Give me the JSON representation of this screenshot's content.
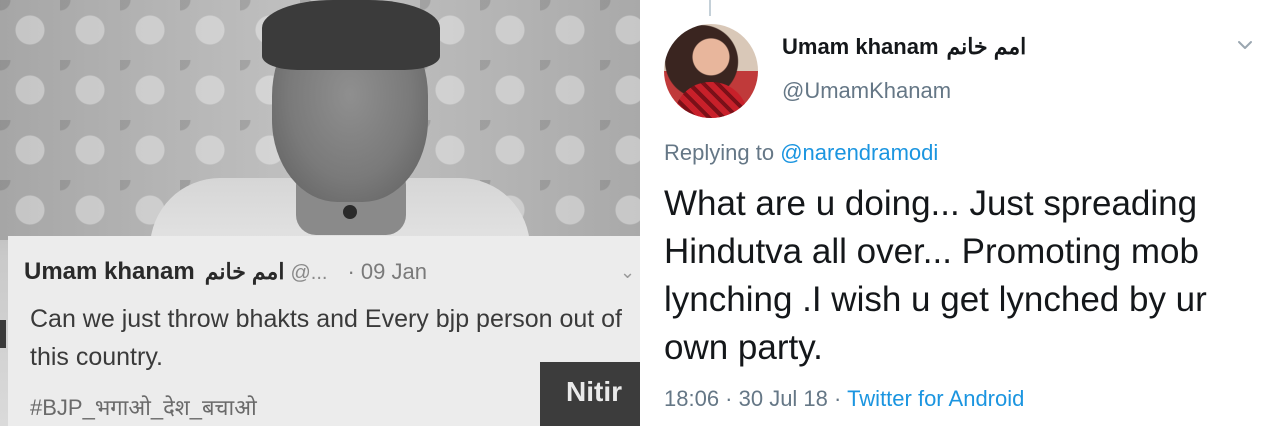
{
  "left_clipping": {
    "tweet": {
      "name": "Umam khanam",
      "urdu_name": "امم خانم",
      "handle": "@...",
      "date": "· 09 Jan",
      "body": "Can we just throw bhakts and Every bjp person out of this country.",
      "hashtag": "#BJP_भगाओ_देश_बचाओ"
    },
    "overlay_label": "Nitir"
  },
  "right_tweet": {
    "display_name": "Umam khanam",
    "urdu_name": "امم خانم",
    "handle": "@UmamKhanam",
    "replying_prefix": "Replying to",
    "replying_to": "@narendramodi",
    "text": "What are u doing... Just spreading Hindutva all over... Promoting mob lynching .I wish u get lynched by ur own party.",
    "time_date": "18:06 · 30 Jul 18 ·",
    "source": "Twitter for Android",
    "colors": {
      "link": "#1b95e0",
      "secondary": "#657786",
      "text": "#14171a"
    },
    "icons": {
      "menu": "chevron-down-icon",
      "avatar": "profile-photo"
    }
  }
}
